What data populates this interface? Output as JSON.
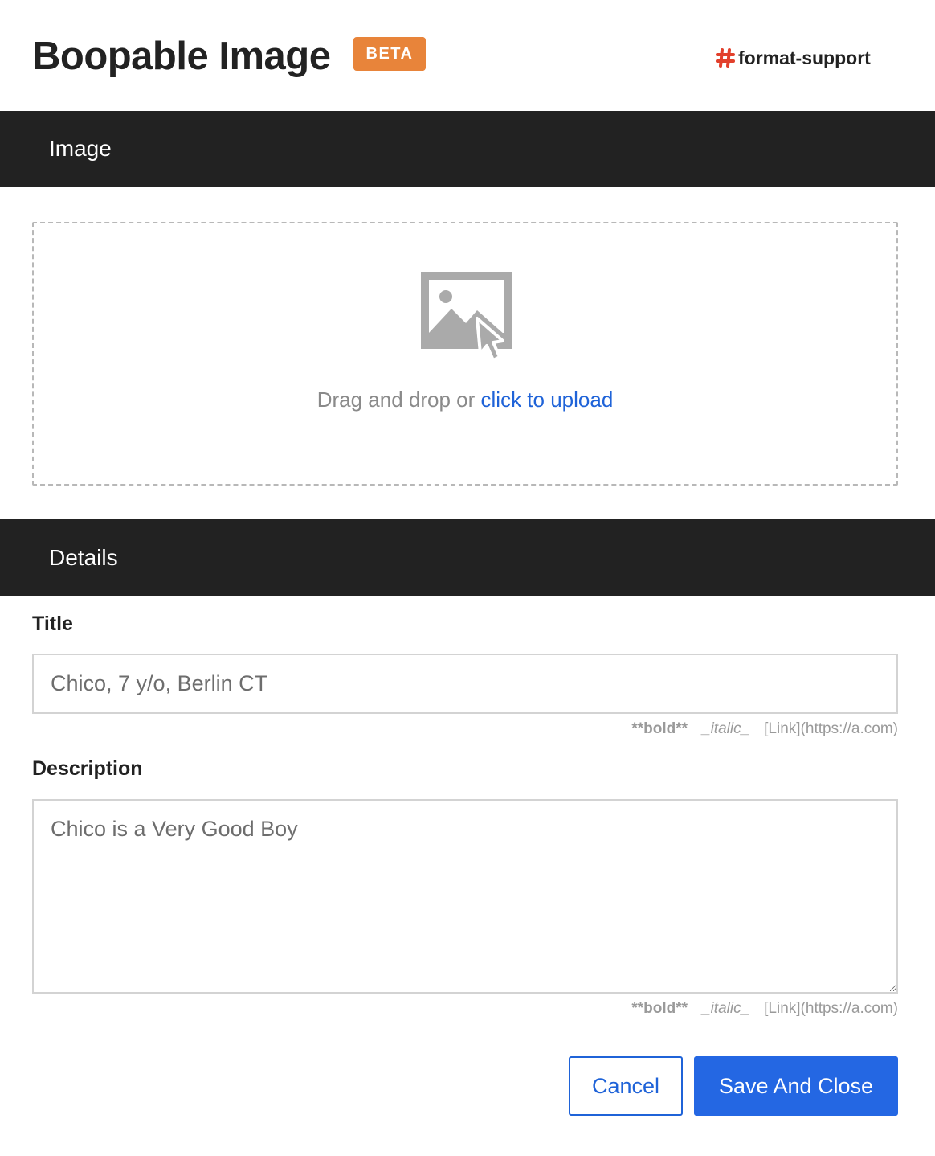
{
  "header": {
    "title": "Boopable Image",
    "badge": "BETA",
    "channel": "format-support",
    "channel_icon": "hash-icon",
    "badge_color": "#e8843a"
  },
  "sections": {
    "image": "Image",
    "details": "Details"
  },
  "dropzone": {
    "icon": "image-upload-icon",
    "text": "Drag and drop or ",
    "link": "click to upload"
  },
  "form": {
    "title_label": "Title",
    "title_value": "Chico, 7 y/o, Berlin CT",
    "description_label": "Description",
    "description_value": "Chico is a Very Good Boy",
    "hints": {
      "bold": "**bold**",
      "italic": "_italic_",
      "link": "[Link](https://a.com)"
    }
  },
  "buttons": {
    "cancel": "Cancel",
    "save": "Save And Close"
  },
  "colors": {
    "accent": "#2467e3",
    "section_bar": "#222222"
  }
}
